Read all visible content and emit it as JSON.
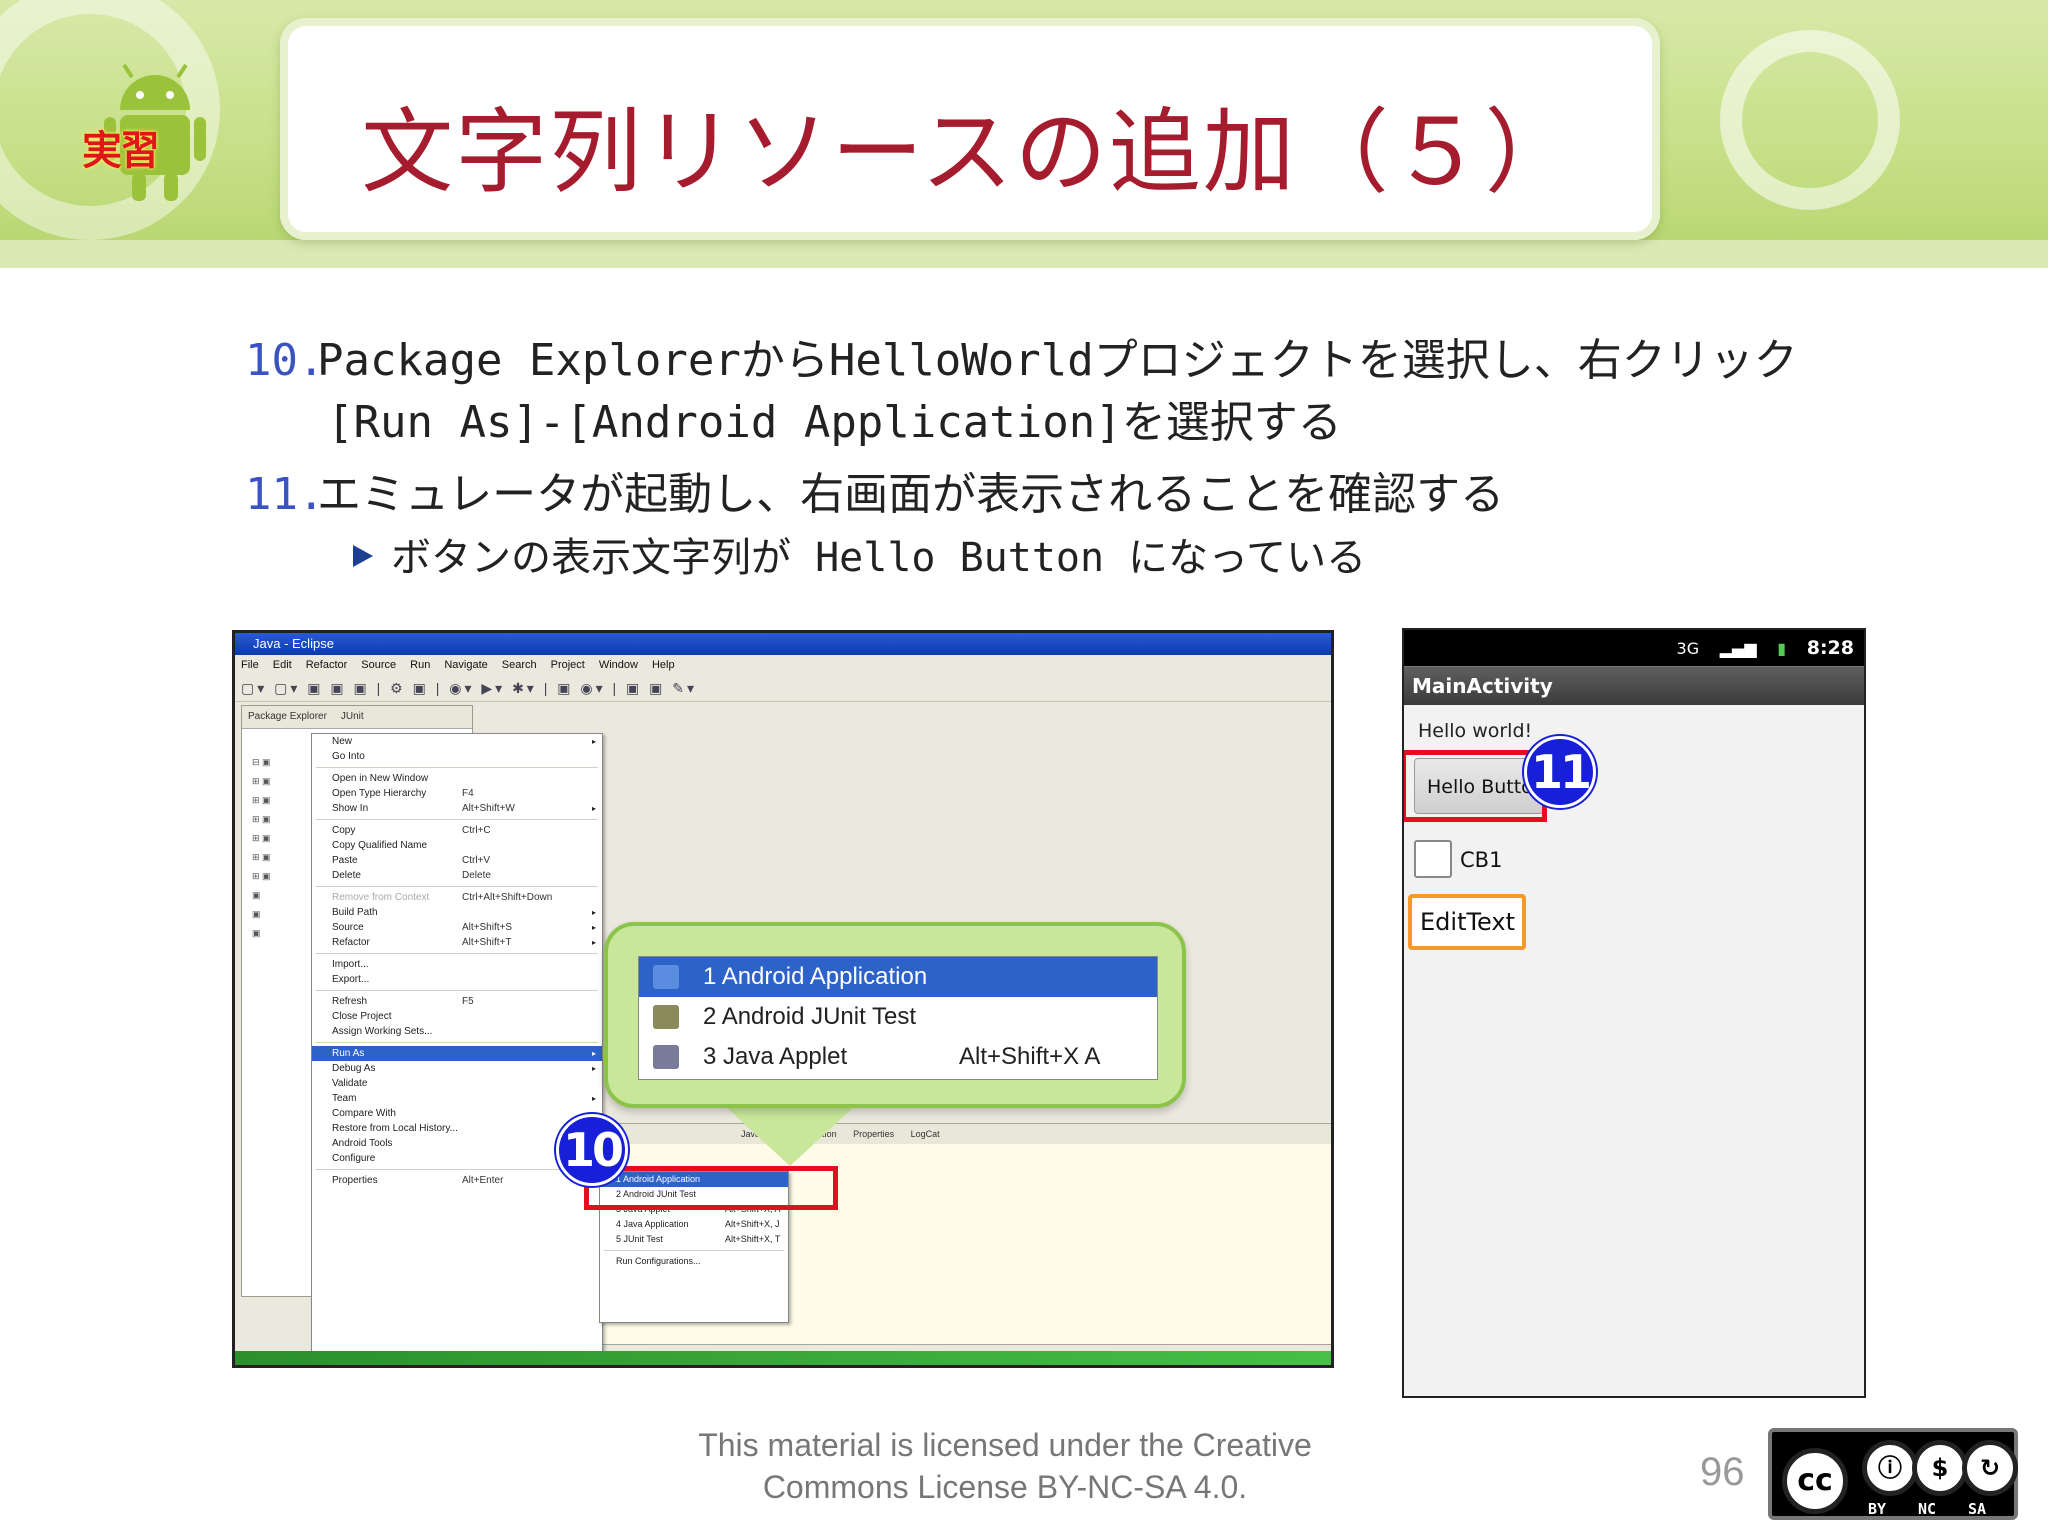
{
  "slide": {
    "title": "文字列リソースの追加（５）",
    "badge_label": "実習",
    "page_number": "96",
    "license_line1": "This material is licensed under the Creative",
    "license_line2": "Commons License BY-NC-SA 4.0.",
    "cc_labels": [
      "BY",
      "NC",
      "SA"
    ],
    "cc_icon_main": "cc",
    "colors": {
      "title": "#a51c2e",
      "number": "#3a53c0",
      "badge": "#1720d8",
      "highlight_box": "#e01020",
      "banner": "#c5df85"
    }
  },
  "steps": [
    {
      "num": "10.",
      "line1": "Package ExplorerからHelloWorldプロジェクトを選択し、右クリック",
      "line2": "[Run As]-[Android Application]を選択する"
    },
    {
      "num": "11.",
      "line1": "エミュレータが起動し、右画面が表示されることを確認する"
    }
  ],
  "sub_bullet": "ボタンの表示文字列が Hello Button になっている",
  "eclipse": {
    "window_title": "Java - Eclipse",
    "menubar": [
      "File",
      "Edit",
      "Refactor",
      "Source",
      "Run",
      "Navigate",
      "Search",
      "Project",
      "Window",
      "Help"
    ],
    "explorer_tabs": [
      "Package Explorer",
      "JUnit"
    ],
    "context_menu": [
      {
        "label": "New",
        "shortcut": "",
        "submenu": true
      },
      {
        "label": "Go Into",
        "shortcut": ""
      },
      {
        "sep": true
      },
      {
        "label": "Open in New Window",
        "shortcut": ""
      },
      {
        "label": "Open Type Hierarchy",
        "shortcut": "F4"
      },
      {
        "label": "Show In",
        "shortcut": "Alt+Shift+W",
        "submenu": true
      },
      {
        "sep": true
      },
      {
        "label": "Copy",
        "shortcut": "Ctrl+C"
      },
      {
        "label": "Copy Qualified Name",
        "shortcut": ""
      },
      {
        "label": "Paste",
        "shortcut": "Ctrl+V"
      },
      {
        "label": "Delete",
        "shortcut": "Delete"
      },
      {
        "sep": true
      },
      {
        "label": "Remove from Context",
        "shortcut": "Ctrl+Alt+Shift+Down",
        "disabled": true
      },
      {
        "label": "Build Path",
        "shortcut": "",
        "submenu": true
      },
      {
        "label": "Source",
        "shortcut": "Alt+Shift+S",
        "submenu": true
      },
      {
        "label": "Refactor",
        "shortcut": "Alt+Shift+T",
        "submenu": true
      },
      {
        "sep": true
      },
      {
        "label": "Import...",
        "shortcut": ""
      },
      {
        "label": "Export...",
        "shortcut": ""
      },
      {
        "sep": true
      },
      {
        "label": "Refresh",
        "shortcut": "F5"
      },
      {
        "label": "Close Project",
        "shortcut": ""
      },
      {
        "label": "Assign Working Sets...",
        "shortcut": ""
      },
      {
        "sep": true
      },
      {
        "label": "Run As",
        "shortcut": "",
        "submenu": true,
        "highlight": true
      },
      {
        "label": "Debug As",
        "shortcut": "",
        "submenu": true
      },
      {
        "label": "Validate",
        "shortcut": ""
      },
      {
        "label": "Team",
        "shortcut": "",
        "submenu": true
      },
      {
        "label": "Compare With",
        "shortcut": "",
        "submenu": true
      },
      {
        "label": "Restore from Local History...",
        "shortcut": ""
      },
      {
        "label": "Android Tools",
        "shortcut": "",
        "submenu": true
      },
      {
        "label": "Configure",
        "shortcut": "",
        "submenu": true
      },
      {
        "sep": true
      },
      {
        "label": "Properties",
        "shortcut": "Alt+Enter"
      }
    ],
    "run_as_submenu": [
      {
        "label": "1 Android Application",
        "shortcut": "",
        "highlight": true
      },
      {
        "label": "2 Android JUnit Test",
        "shortcut": ""
      },
      {
        "label": "3 Java Applet",
        "shortcut": "Alt+Shift+X, A"
      },
      {
        "label": "4 Java Application",
        "shortcut": "Alt+Shift+X, J"
      },
      {
        "label": "5 JUnit Test",
        "shortcut": "Alt+Shift+X, T"
      },
      {
        "label": "Run Configurations...",
        "shortcut": ""
      }
    ],
    "bottom_tabs": [
      "Javadoc",
      "Declaration",
      "Properties",
      "LogCat"
    ],
    "callout_items": [
      {
        "label": "1 Android Application",
        "shortcut": "",
        "icon": "android-app-icon",
        "highlight": true
      },
      {
        "label": "2 Android JUnit Test",
        "shortcut": "",
        "icon": "junit-icon"
      },
      {
        "label": "3 Java Applet",
        "shortcut": "Alt+Shift+X  A",
        "icon": "applet-icon"
      }
    ],
    "step_badge": "10"
  },
  "phone": {
    "time": "8:28",
    "network": "3G",
    "app_title": "MainActivity",
    "hello_text": "Hello world!",
    "button_text": "Hello Button",
    "checkbox_label": "CB1",
    "edittext_value": "EditText",
    "step_badge": "11"
  }
}
